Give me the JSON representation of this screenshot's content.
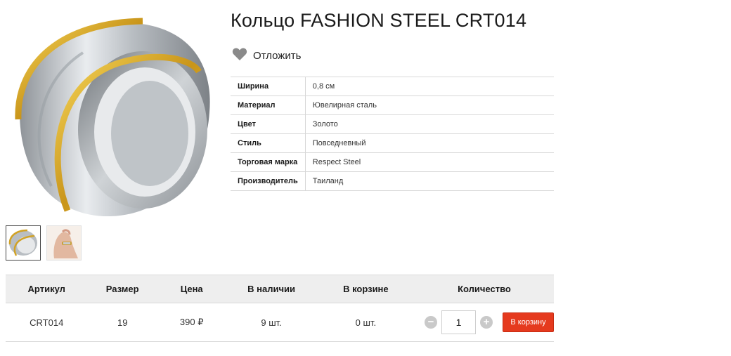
{
  "product": {
    "title": "Кольцо FASHION STEEL CRT014",
    "defer_label": "Отложить",
    "image_alt": "ring-photo"
  },
  "specs": [
    {
      "key": "Ширина",
      "value": "0,8 см"
    },
    {
      "key": "Материал",
      "value": "Ювелирная сталь"
    },
    {
      "key": "Цвет",
      "value": "Золото"
    },
    {
      "key": "Стиль",
      "value": "Повседневный"
    },
    {
      "key": "Торговая марка",
      "value": "Respect Steel"
    },
    {
      "key": "Производитель",
      "value": "Таиланд"
    }
  ],
  "offers": {
    "headers": [
      "Артикул",
      "Размер",
      "Цена",
      "В наличии",
      "В корзине",
      "Количество"
    ],
    "row": {
      "article": "CRT014",
      "size": "19",
      "price": "390 ₽",
      "in_stock": "9 шт.",
      "in_cart": "0 шт.",
      "quantity": "1",
      "minus": "−",
      "plus": "+",
      "cart_button": "В корзину"
    }
  },
  "colors": {
    "accent": "#e53a1e",
    "gold": "#d4a017",
    "steel": "#b8b8b8"
  }
}
